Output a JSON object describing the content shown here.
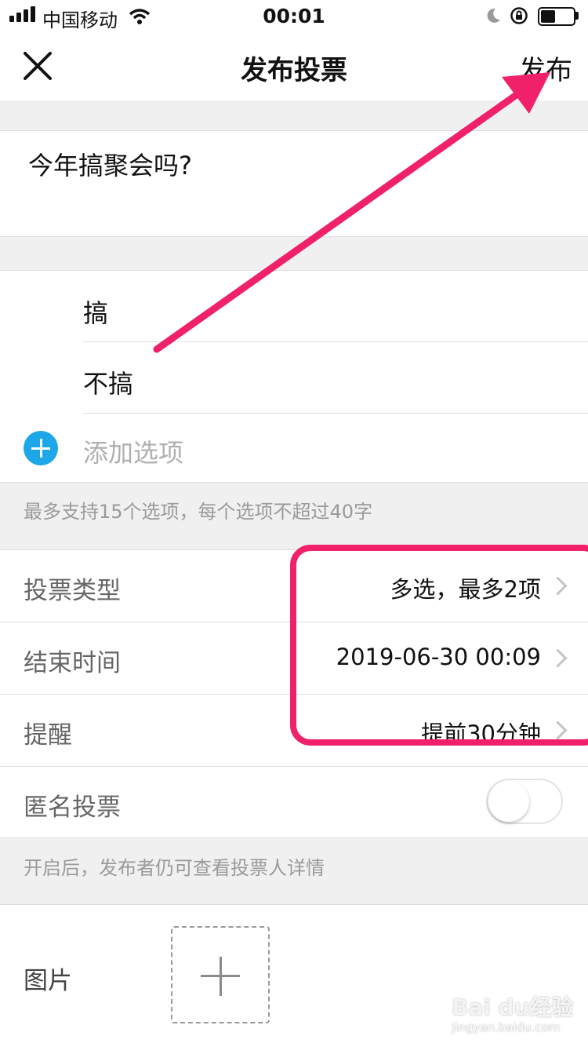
{
  "status_bar": {
    "carrier": "中国移动",
    "time": "00:01"
  },
  "nav": {
    "title": "发布投票",
    "publish": "发布"
  },
  "question": "今年搞聚会吗?",
  "options": [
    "搞",
    "不搞"
  ],
  "add_option": "添加选项",
  "options_hint": "最多支持15个选项，每个选项不超过40字",
  "settings": [
    {
      "label": "投票类型",
      "value": "多选，最多2项"
    },
    {
      "label": "结束时间",
      "value": "2019-06-30 00:09"
    },
    {
      "label": "提醒",
      "value": "提前30分钟"
    }
  ],
  "anonymous": {
    "label": "匿名投票",
    "enabled": false
  },
  "anonymous_hint": "开启后，发布者仍可查看投票人详情",
  "image_label": "图片",
  "watermark": {
    "text": "Bai du经验",
    "sub": "jingyan.baidu.com"
  },
  "colors": {
    "accent": "#1ea7e8",
    "annotation": "#f0216a"
  }
}
